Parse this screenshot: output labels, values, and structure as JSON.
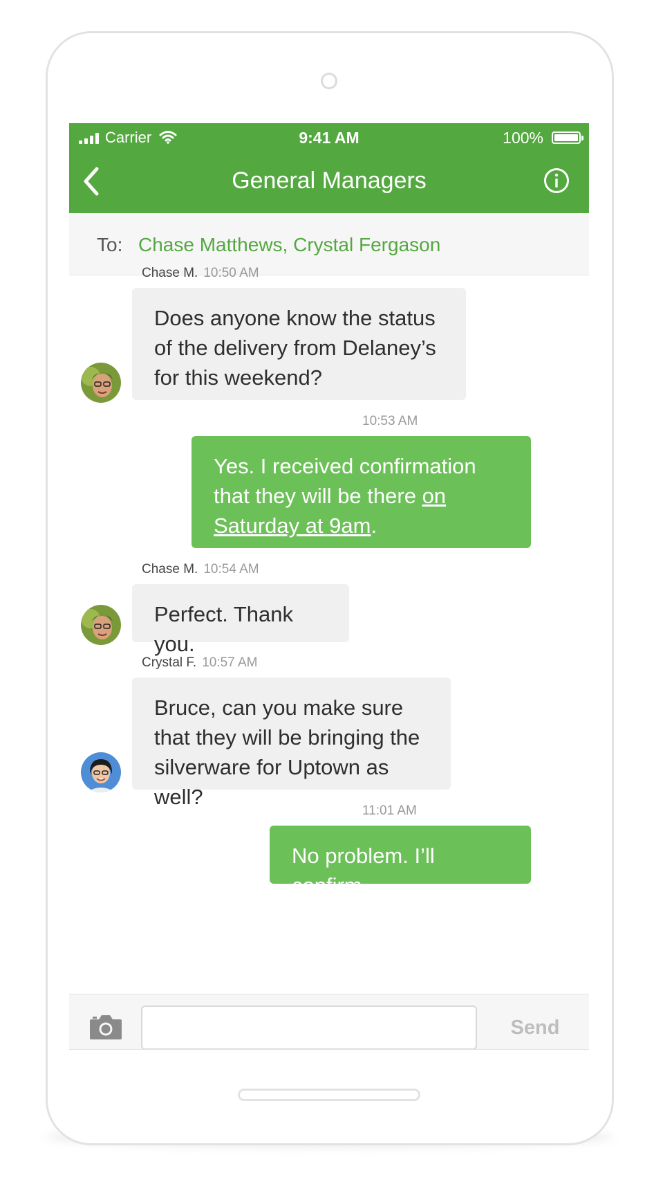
{
  "status_bar": {
    "carrier": "Carrier",
    "time": "9:41 AM",
    "battery": "100%"
  },
  "nav": {
    "title": "General Managers",
    "back_icon": "chevron-left-icon",
    "info_icon": "info-icon"
  },
  "recipients": {
    "label": "To:",
    "names": "Chase Matthews, Crystal Fergason"
  },
  "messages": [
    {
      "direction": "incoming",
      "sender": "Chase M.",
      "time": "10:50 AM",
      "text": "Does anyone know the status of the delivery from Delaney’s for this weekend?"
    },
    {
      "direction": "outgoing",
      "time": "10:53 AM",
      "text_before": "Yes. I received confirmation that they will be there ",
      "link_text": "on Saturday at 9am",
      "text_after": "."
    },
    {
      "direction": "incoming",
      "sender": "Chase M.",
      "time": "10:54 AM",
      "text": "Perfect. Thank you."
    },
    {
      "direction": "incoming",
      "sender": "Crystal F.",
      "time": "10:57 AM",
      "text": "Bruce, can you make sure that they will be bringing the silverware for Uptown as well?"
    },
    {
      "direction": "outgoing",
      "time": "11:01 AM",
      "text": "No problem. I’ll confirm."
    }
  ],
  "compose": {
    "camera_icon": "camera-icon",
    "input_value": "",
    "send_label": "Send"
  },
  "colors": {
    "brand_green": "#54a840",
    "outgoing_bubble": "#6cc058",
    "incoming_bubble": "#f0f0f0"
  }
}
